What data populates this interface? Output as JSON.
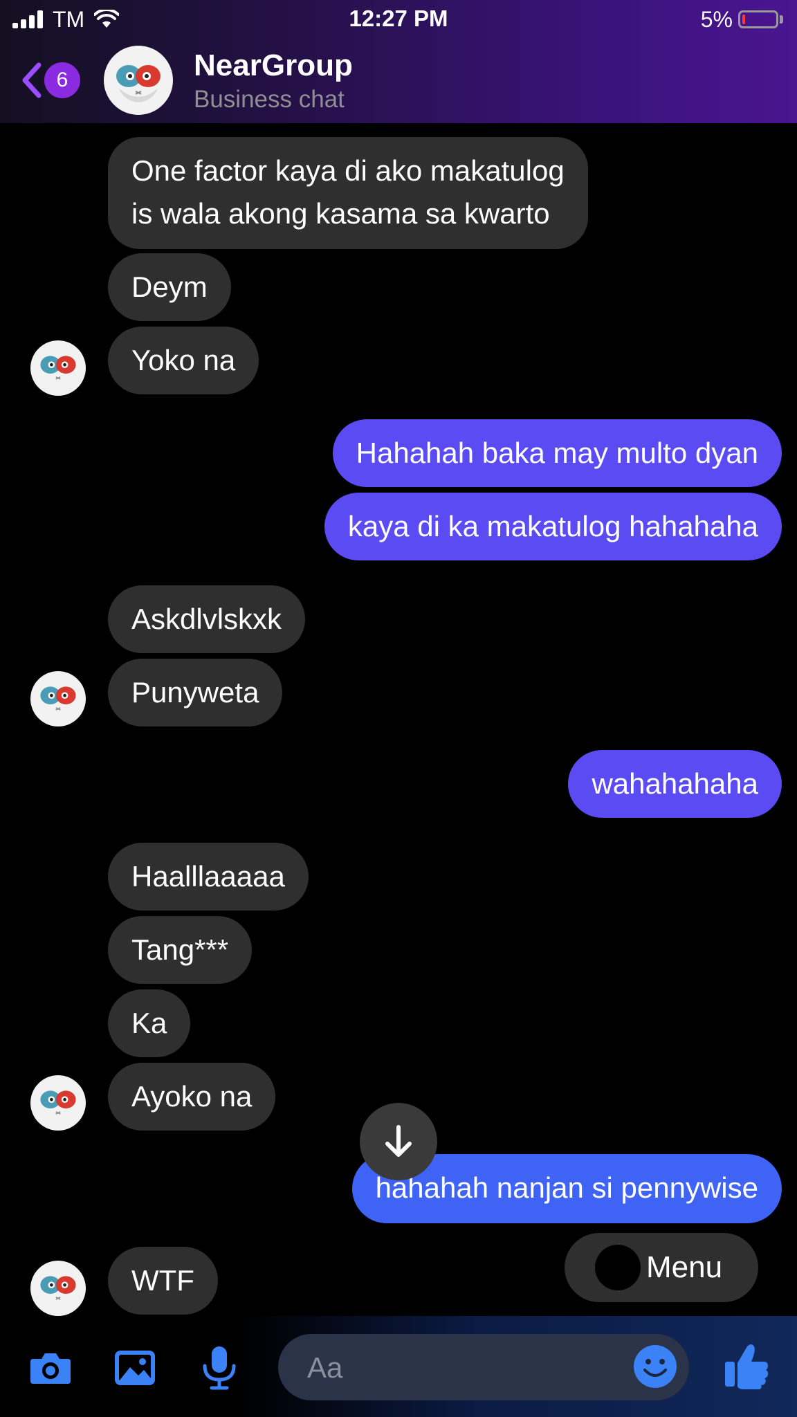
{
  "status_bar": {
    "carrier": "TM",
    "time": "12:27 PM",
    "battery_percent": "5%"
  },
  "header": {
    "unread_badge": "6",
    "title": "NearGroup",
    "subtitle": "Business chat"
  },
  "messages": [
    {
      "from": "them",
      "lines": [
        "One factor kaya di ako makatulog",
        "is wala akong kasama sa kwarto"
      ]
    },
    {
      "from": "them",
      "text": "Deym"
    },
    {
      "from": "them",
      "text": "Yoko na"
    },
    {
      "from": "me",
      "text": "Hahahah baka may multo dyan"
    },
    {
      "from": "me",
      "text": "kaya di ka makatulog hahahaha"
    },
    {
      "from": "them",
      "text": "Askdlvlskxk"
    },
    {
      "from": "them",
      "text": "Punyweta"
    },
    {
      "from": "me",
      "text": "wahahahaha"
    },
    {
      "from": "them",
      "text": "Haalllaaaaa"
    },
    {
      "from": "them",
      "text": "Tang***"
    },
    {
      "from": "them",
      "text": "Ka"
    },
    {
      "from": "them",
      "text": "Ayoko na"
    },
    {
      "from": "me",
      "text": "hahahah nanjan si pennywise"
    },
    {
      "from": "them",
      "text": "WTF"
    }
  ],
  "menu_button": {
    "label": "Menu"
  },
  "composer": {
    "placeholder": "Aa"
  },
  "colors": {
    "incoming_bubble": "#2f2f2f",
    "outgoing_bubble": "#5a4cf2",
    "accent_icon": "#3b82f6",
    "badge": "#8a2be2"
  },
  "icons": [
    "back-chevron-icon",
    "camera-icon",
    "gallery-icon",
    "microphone-icon",
    "emoji-icon",
    "thumbs-up-icon",
    "arrow-down-icon"
  ]
}
